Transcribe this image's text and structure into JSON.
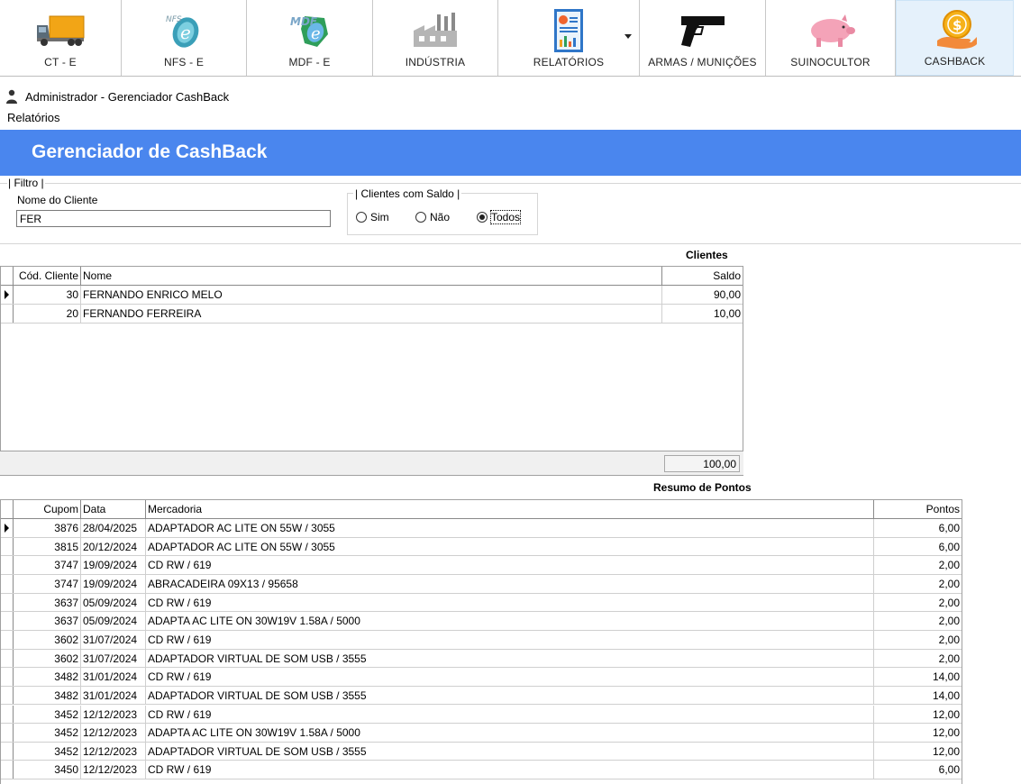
{
  "toolbar": {
    "items": [
      {
        "label": "CT - E",
        "icon": "truck-icon"
      },
      {
        "label": "NFS - E",
        "icon": "nfse-icon"
      },
      {
        "label": "MDF - E",
        "icon": "mdfe-icon"
      },
      {
        "label": "INDÚSTRIA",
        "icon": "factory-icon"
      },
      {
        "label": "RELATÓRIOS",
        "icon": "report-icon"
      },
      {
        "label": "ARMAS / MUNIÇÕES",
        "icon": "pistol-icon"
      },
      {
        "label": "SUINOCULTOR",
        "icon": "pig-icon"
      },
      {
        "label": "CASHBACK",
        "icon": "cashback-icon"
      }
    ],
    "active": "CASHBACK"
  },
  "window": {
    "title": "Administrador - Gerenciador CashBack"
  },
  "menu": {
    "relatorios": "Relatórios"
  },
  "banner": {
    "title": "Gerenciador de CashBack",
    "color": "#4a86ee"
  },
  "filter": {
    "legend": "| Filtro |",
    "nome_label": "Nome do Cliente",
    "nome_value": "FER",
    "saldo_legend": "| Clientes com Saldo |",
    "options": [
      "Sim",
      "Não",
      "Todos"
    ],
    "selected": "Todos"
  },
  "clientes": {
    "caption": "Clientes",
    "headers": {
      "cod": "Cód. Cliente",
      "nome": "Nome",
      "saldo": "Saldo"
    },
    "rows": [
      {
        "cod": "30",
        "nome": "FERNANDO ENRICO MELO",
        "saldo": "90,00"
      },
      {
        "cod": "20",
        "nome": "FERNANDO FERREIRA",
        "saldo": "10,00"
      }
    ],
    "total": "100,00"
  },
  "pontos": {
    "caption": "Resumo de Pontos",
    "headers": {
      "cupom": "Cupom",
      "data": "Data",
      "mercadoria": "Mercadoria",
      "pontos": "Pontos"
    },
    "rows": [
      {
        "cupom": "3876",
        "data": "28/04/2025",
        "mercadoria": "ADAPTADOR AC LITE ON 55W / 3055",
        "pontos": "6,00"
      },
      {
        "cupom": "3815",
        "data": "20/12/2024",
        "mercadoria": "ADAPTADOR AC LITE ON 55W / 3055",
        "pontos": "6,00"
      },
      {
        "cupom": "3747",
        "data": "19/09/2024",
        "mercadoria": "CD RW / 619",
        "pontos": "2,00"
      },
      {
        "cupom": "3747",
        "data": "19/09/2024",
        "mercadoria": "ABRACADEIRA 09X13 / 95658",
        "pontos": "2,00"
      },
      {
        "cupom": "3637",
        "data": "05/09/2024",
        "mercadoria": "CD RW / 619",
        "pontos": "2,00"
      },
      {
        "cupom": "3637",
        "data": "05/09/2024",
        "mercadoria": "ADAPTA AC LITE ON 30W19V 1.58A / 5000",
        "pontos": "2,00"
      },
      {
        "cupom": "3602",
        "data": "31/07/2024",
        "mercadoria": "CD RW / 619",
        "pontos": "2,00"
      },
      {
        "cupom": "3602",
        "data": "31/07/2024",
        "mercadoria": "ADAPTADOR VIRTUAL DE SOM USB / 3555",
        "pontos": "2,00"
      },
      {
        "cupom": "3482",
        "data": "31/01/2024",
        "mercadoria": "CD RW / 619",
        "pontos": "14,00"
      },
      {
        "cupom": "3482",
        "data": "31/01/2024",
        "mercadoria": "ADAPTADOR VIRTUAL DE SOM USB / 3555",
        "pontos": "14,00"
      },
      {
        "cupom": "3452",
        "data": "12/12/2023",
        "mercadoria": "CD RW / 619",
        "pontos": "12,00"
      },
      {
        "cupom": "3452",
        "data": "12/12/2023",
        "mercadoria": "ADAPTA AC LITE ON 30W19V 1.58A / 5000",
        "pontos": "12,00"
      },
      {
        "cupom": "3452",
        "data": "12/12/2023",
        "mercadoria": "ADAPTADOR VIRTUAL DE SOM USB / 3555",
        "pontos": "12,00"
      },
      {
        "cupom": "3450",
        "data": "12/12/2023",
        "mercadoria": "CD RW / 619",
        "pontos": "6,00"
      }
    ]
  }
}
